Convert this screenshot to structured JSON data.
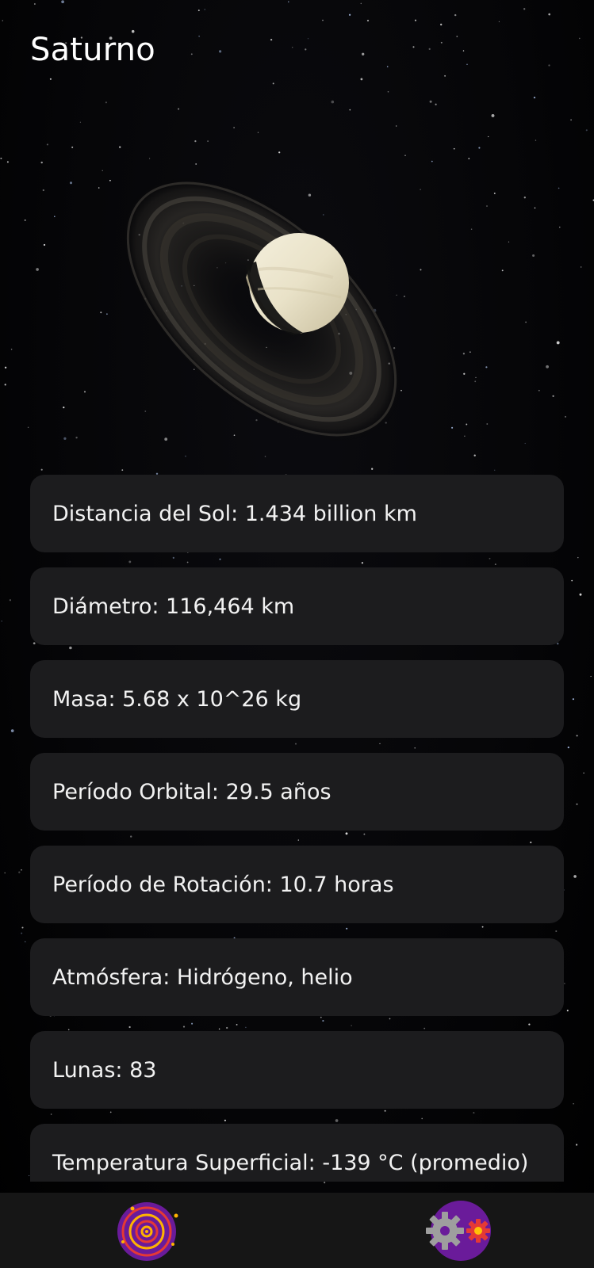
{
  "header": {
    "title": "Saturno"
  },
  "planet_image": {
    "icon": "saturn-planet-image"
  },
  "info": {
    "items": [
      {
        "label": "Distancia del Sol: 1.434 billion km"
      },
      {
        "label": "Diámetro: 116,464 km"
      },
      {
        "label": "Masa: 5.68 x 10^26 kg"
      },
      {
        "label": "Período Orbital: 29.5 años"
      },
      {
        "label": "Período de Rotación: 10.7 horas"
      },
      {
        "label": "Atmósfera: Hidrógeno, helio"
      },
      {
        "label": "Lunas: 83"
      },
      {
        "label": "Temperatura Superficial: -139 °C (promedio)"
      }
    ]
  },
  "bottom_nav": {
    "items": [
      {
        "icon": "solar-system-icon"
      },
      {
        "icon": "settings-gear-icon"
      }
    ]
  },
  "colors": {
    "background": "#000000",
    "card": "#1c1c1e",
    "nav_bar": "#161616",
    "accent_purple": "#6a1b9a",
    "accent_yellow": "#ffc107",
    "accent_red": "#e53935"
  }
}
